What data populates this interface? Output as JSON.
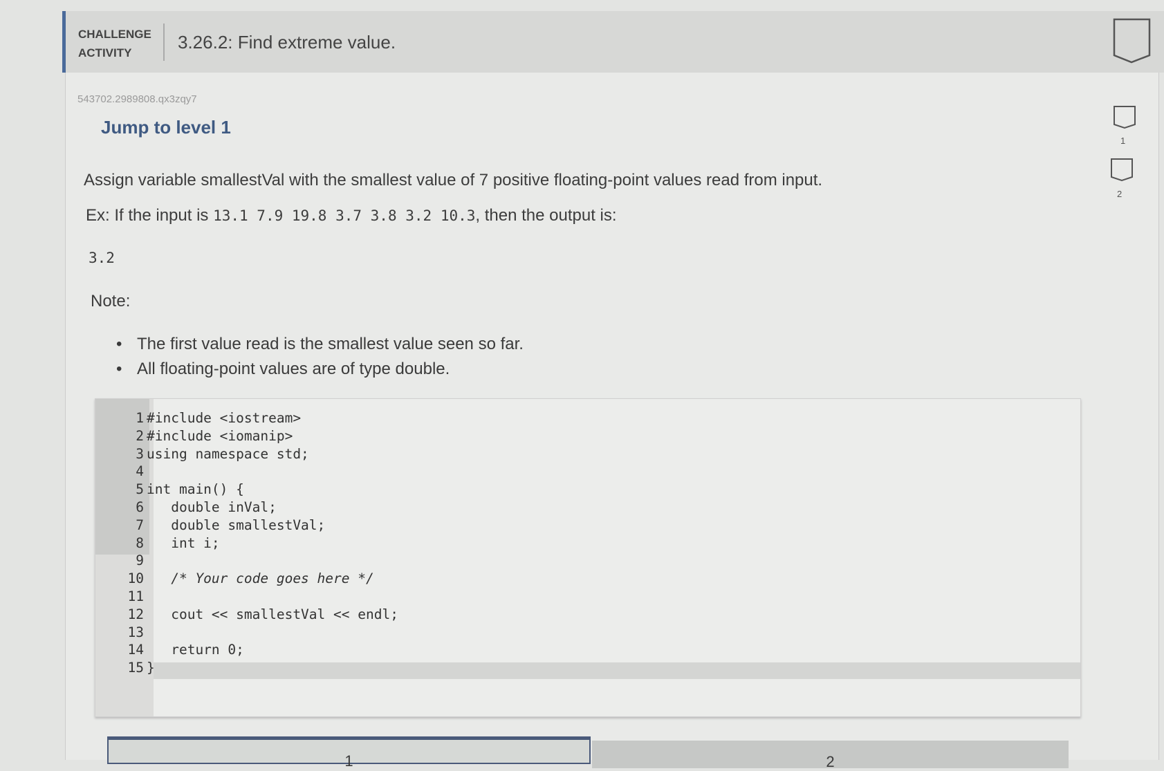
{
  "header": {
    "label_line1": "CHALLENGE",
    "label_line2": "ACTIVITY",
    "title": "3.26.2: Find extreme value."
  },
  "activity_id": "543702.2989808.qx3zqy7",
  "level_title": "Jump to level 1",
  "prompt": "Assign variable smallestVal with the smallest value of 7 positive floating-point values read from input.",
  "example": {
    "prefix": "Ex: If the input is ",
    "input": "13.1 7.9 19.8 3.7 3.8 3.2 10.3",
    "suffix": ", then the output is:",
    "output": "3.2"
  },
  "note_label": "Note:",
  "notes": [
    "The first value read is the smallest value seen so far.",
    "All floating-point values are of type double."
  ],
  "code_lines": [
    {
      "n": "1",
      "text": "#include <iostream>"
    },
    {
      "n": "2",
      "text": "#include <iomanip>"
    },
    {
      "n": "3",
      "text": "using namespace std;"
    },
    {
      "n": "4",
      "text": ""
    },
    {
      "n": "5",
      "text": "int main() {"
    },
    {
      "n": "6",
      "text": "   double inVal;"
    },
    {
      "n": "7",
      "text": "   double smallestVal;"
    },
    {
      "n": "8",
      "text": "   int i;"
    },
    {
      "n": "9",
      "text": ""
    },
    {
      "n": "10",
      "text": "   /* Your code goes here */"
    },
    {
      "n": "11",
      "text": ""
    },
    {
      "n": "12",
      "text": "   cout << smallestVal << endl;"
    },
    {
      "n": "13",
      "text": ""
    },
    {
      "n": "14",
      "text": "   return 0;"
    },
    {
      "n": "15",
      "text": "}"
    }
  ],
  "level_badges": [
    {
      "label": "1"
    },
    {
      "label": "2"
    }
  ],
  "tabs": [
    {
      "label": "1"
    },
    {
      "label": "2"
    }
  ],
  "colors": {
    "accent": "#3f5a82",
    "header_bg": "#d7d8d6"
  }
}
